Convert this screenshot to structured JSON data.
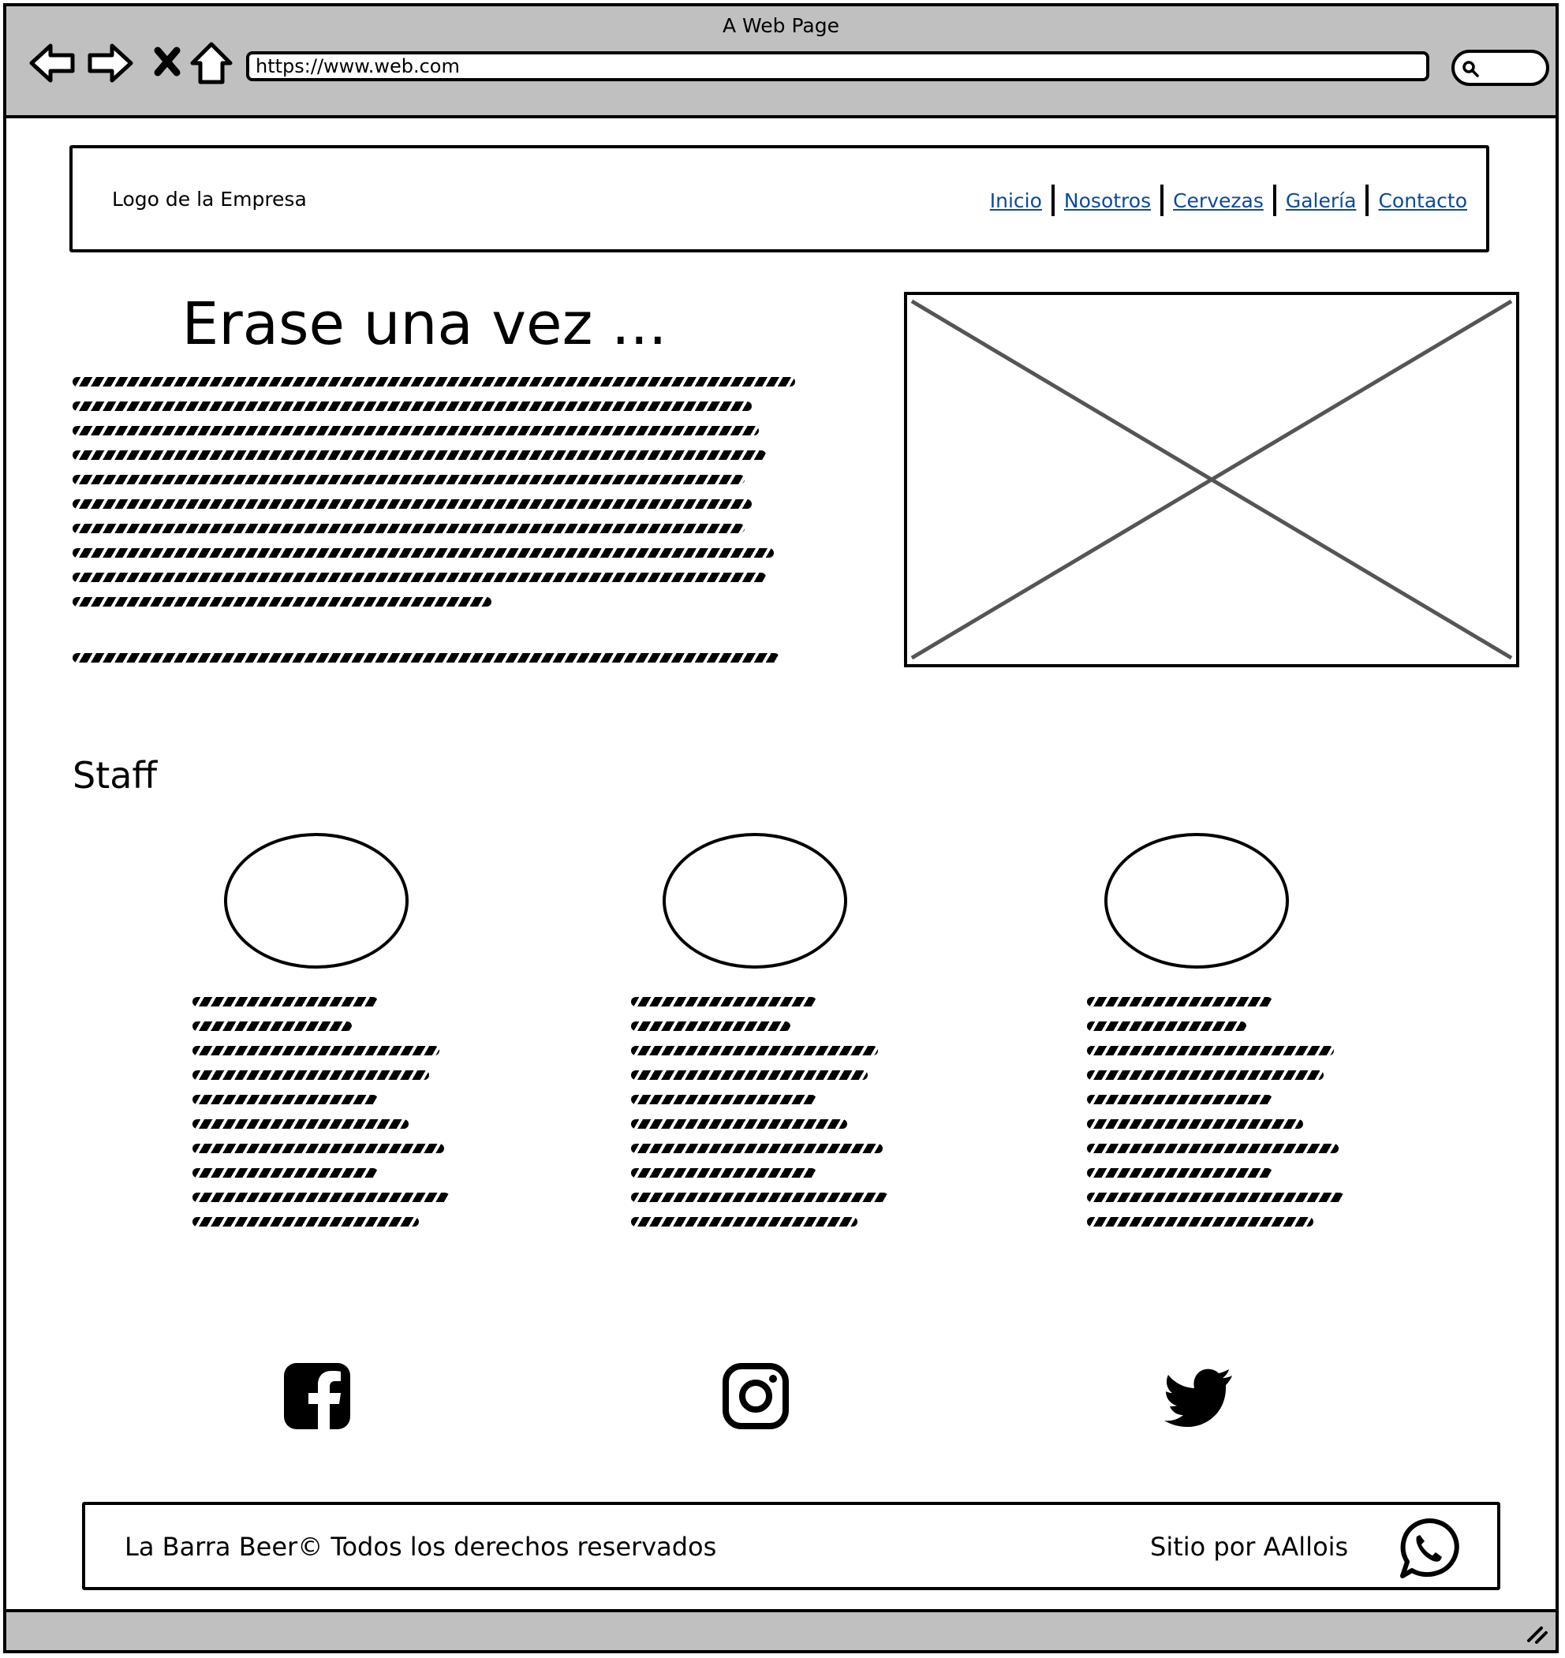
{
  "window": {
    "title": "A Web Page"
  },
  "browser": {
    "url": "https://www.web.com",
    "icons": [
      "back-arrow-icon",
      "forward-arrow-icon",
      "close-icon",
      "home-icon",
      "search-icon"
    ]
  },
  "header": {
    "logo": "Logo de la Empresa",
    "nav": [
      {
        "label": "Inicio"
      },
      {
        "label": "Nosotros"
      },
      {
        "label": "Cervezas"
      },
      {
        "label": "Galería"
      },
      {
        "label": "Contacto"
      }
    ]
  },
  "story": {
    "title": "Erase una vez ..."
  },
  "staff": {
    "title": "Staff",
    "members": 3
  },
  "social": {
    "icons": [
      "facebook-icon",
      "instagram-icon",
      "twitter-icon"
    ]
  },
  "footer": {
    "copyright": "La Barra Beer© Todos los derechos reservados",
    "credit": "Sitio por AAllois",
    "icon": "whatsapp-icon"
  },
  "colors": {
    "chrome": "#c0c0c0",
    "link": "#0b4a9c",
    "ink": "#000000",
    "placeholder_x": "#555555"
  }
}
